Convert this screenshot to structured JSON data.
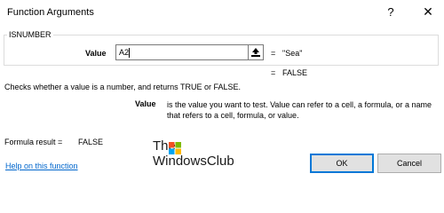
{
  "window": {
    "title": "Function Arguments",
    "help_glyph": "?",
    "close_glyph": "✕"
  },
  "function": {
    "name": "ISNUMBER",
    "argument": {
      "label": "Value",
      "input_value": "A2",
      "equals": "=",
      "evaluated": "\"Sea\"",
      "collapse_icon": "collapse-arrow-icon"
    },
    "result_equals": "=",
    "result_value": "FALSE",
    "description": "Checks whether a value is a number, and returns TRUE or FALSE.",
    "param_name": "Value",
    "param_description": "is the value you want to test. Value can refer to a cell, a formula, or a name that refers to a cell, formula, or value."
  },
  "footer": {
    "formula_result_label": "Formula result =",
    "formula_result_value": "FALSE",
    "help_link": "Help on this function",
    "ok_label": "OK",
    "cancel_label": "Cancel"
  },
  "watermark": {
    "line1": "The",
    "line2": "WindowsClub"
  },
  "colors": {
    "link": "#0066cc",
    "ok_border": "#0078d7",
    "button_bg": "#e1e1e1"
  }
}
